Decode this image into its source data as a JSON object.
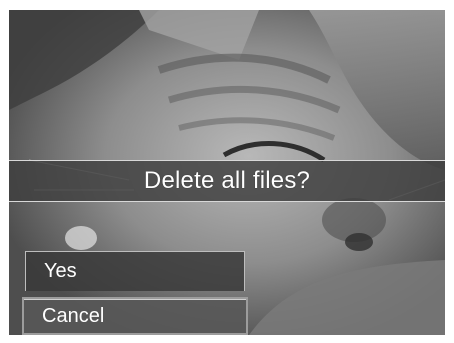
{
  "dialog": {
    "title": "Delete all files?",
    "options": [
      {
        "label": "Yes"
      },
      {
        "label": "Cancel",
        "selected": true
      }
    ]
  },
  "colors": {
    "banner_bg": "#3e3e3e",
    "option_bg": "#3a3a3a",
    "selected_bg": "#585858",
    "text": "#ffffff"
  }
}
